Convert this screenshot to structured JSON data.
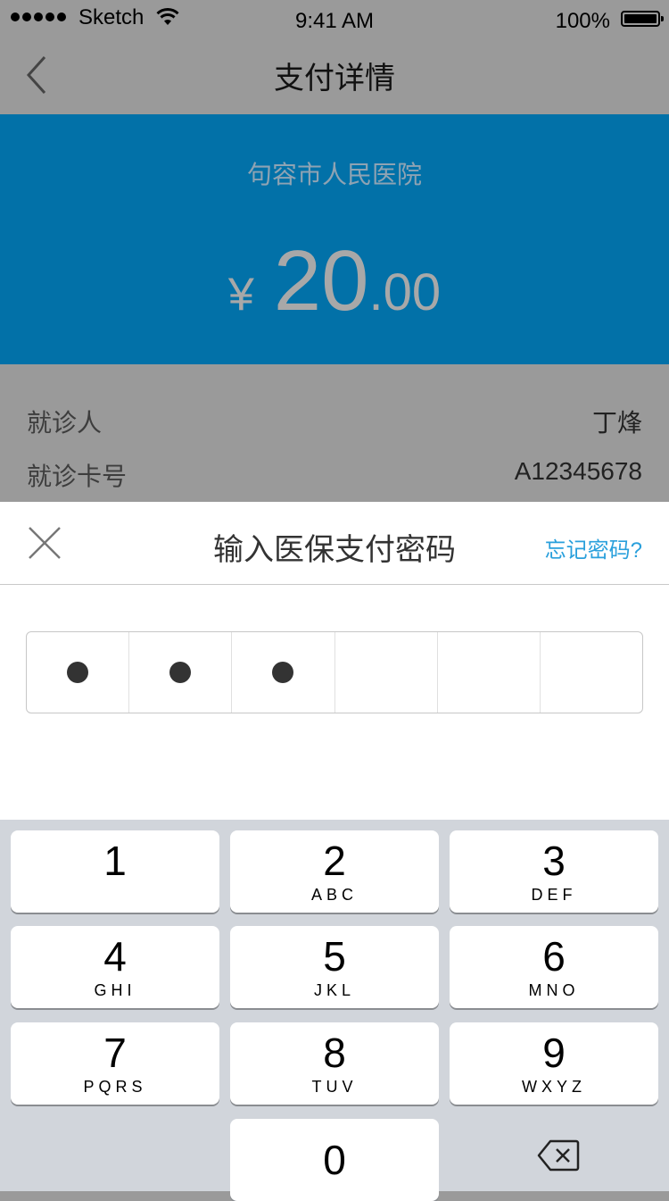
{
  "status_bar": {
    "carrier": "Sketch",
    "time": "9:41 AM",
    "battery": "100%"
  },
  "nav": {
    "title": "支付详情"
  },
  "hero": {
    "hospital": "句容市人民医院",
    "currency": "¥",
    "amount_integer": "20",
    "amount_decimal": ".00",
    "background_color": "#0271a8"
  },
  "details": [
    {
      "label": "就诊人",
      "value": "丁烽"
    },
    {
      "label": "就诊卡号",
      "value": "A12345678"
    }
  ],
  "password_sheet": {
    "title": "输入医保支付密码",
    "forgot_link": "忘记密码?",
    "digits_total": 6,
    "digits_entered": 3
  },
  "keypad": {
    "keys": [
      {
        "num": "1",
        "letters": ""
      },
      {
        "num": "2",
        "letters": "ABC"
      },
      {
        "num": "3",
        "letters": "DEF"
      },
      {
        "num": "4",
        "letters": "GHI"
      },
      {
        "num": "5",
        "letters": "JKL"
      },
      {
        "num": "6",
        "letters": "MNO"
      },
      {
        "num": "7",
        "letters": "PQRS"
      },
      {
        "num": "8",
        "letters": "TUV"
      },
      {
        "num": "9",
        "letters": "WXYZ"
      },
      {
        "num": "0",
        "letters": ""
      }
    ],
    "delete_icon": "backspace-icon"
  }
}
